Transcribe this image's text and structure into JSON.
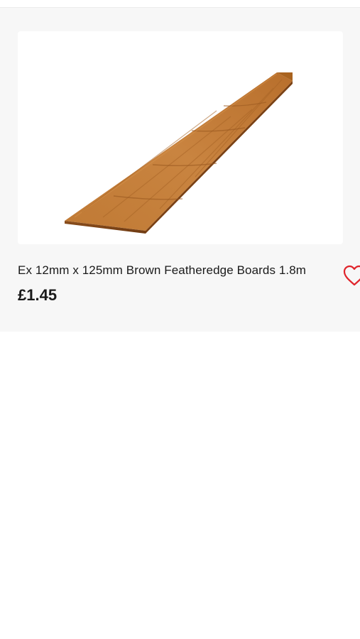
{
  "product": {
    "title": "Ex 12mm x 125mm Brown Featheredge Boards 1.8m",
    "price": "£1.45",
    "image_subject": "brown featheredge timber board",
    "wishlist_icon": "heart-outline-icon",
    "wishlist_color": "#e0242b"
  }
}
